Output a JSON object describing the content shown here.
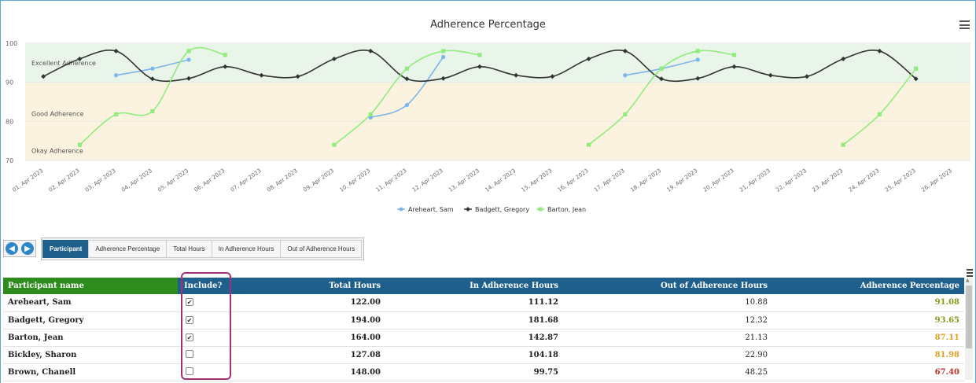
{
  "chart_data": {
    "type": "line",
    "title": "Adherence Percentage",
    "ylim": [
      70,
      100
    ],
    "yticks": [
      "70",
      "80",
      "90",
      "100"
    ],
    "bands": [
      {
        "label": "Excellent Adherence",
        "from": 90,
        "to": 100,
        "color": "#e9f5e9"
      },
      {
        "label": "Good Adherence",
        "from": 70,
        "to": 90,
        "color": "#fbf3e0"
      },
      {
        "label": "Okay Adherence",
        "from": 70,
        "to": 70,
        "color": "#fbf3e0"
      }
    ],
    "categories": [
      "01, Apr 2023",
      "02, Apr 2023",
      "03, Apr 2023",
      "04, Apr 2023",
      "05, Apr 2023",
      "06, Apr 2023",
      "07, Apr 2023",
      "08, Apr 2023",
      "09, Apr 2023",
      "10, Apr 2023",
      "11, Apr 2023",
      "12, Apr 2023",
      "13, Apr 2023",
      "14, Apr 2023",
      "15, Apr 2023",
      "16, Apr 2023",
      "17, Apr 2023",
      "18, Apr 2023",
      "19, Apr 2023",
      "20, Apr 2023",
      "21, Apr 2023",
      "22, Apr 2023",
      "23, Apr 2023",
      "24, Apr 2023",
      "25, Apr 2023",
      "26, Apr 2023"
    ],
    "series": [
      {
        "name": "Areheart, Sam",
        "color": "#7cb5ec",
        "marker": "circle",
        "values": [
          null,
          null,
          91.8,
          93.5,
          95.8,
          null,
          null,
          null,
          null,
          81.0,
          84.2,
          96.5,
          null,
          null,
          null,
          null,
          91.8,
          93.5,
          95.8,
          null,
          null,
          null,
          null,
          null,
          null,
          null
        ]
      },
      {
        "name": "Badgett, Gregory",
        "color": "#333333",
        "marker": "diamond",
        "values": [
          91.5,
          96.0,
          98.0,
          90.9,
          91.0,
          94.0,
          91.8,
          91.5,
          96.0,
          98.0,
          90.9,
          91.0,
          94.0,
          91.8,
          91.5,
          96.0,
          98.0,
          90.9,
          91.0,
          94.0,
          91.8,
          91.5,
          96.0,
          98.0,
          90.9,
          null
        ]
      },
      {
        "name": "Barton, Jean",
        "color": "#90ed7d",
        "marker": "square",
        "values": [
          null,
          74.0,
          81.8,
          82.6,
          98.0,
          97.0,
          null,
          null,
          74.0,
          81.8,
          93.5,
          98.0,
          97.0,
          null,
          null,
          74.0,
          81.8,
          93.5,
          98.0,
          97.0,
          null,
          null,
          74.0,
          81.8,
          93.5,
          null
        ]
      }
    ]
  },
  "tabs": {
    "items": [
      "Participant",
      "Adherence Percentage",
      "Total Hours",
      "In Adherence Hours",
      "Out of Adherence Hours"
    ]
  },
  "table": {
    "headers": {
      "name": "Participant name",
      "include": "Include?",
      "total": "Total Hours",
      "in": "In Adherence Hours",
      "out": "Out of Adherence Hours",
      "pct": "Adherence Percentage"
    },
    "rows": [
      {
        "name": "Areheart, Sam",
        "include": true,
        "total": "122.00",
        "in": "111.12",
        "out": "10.88",
        "pct": "91.08",
        "pct_color": "#8a9a1a"
      },
      {
        "name": "Badgett, Gregory",
        "include": true,
        "total": "194.00",
        "in": "181.68",
        "out": "12.32",
        "pct": "93.65",
        "pct_color": "#8a9a1a"
      },
      {
        "name": "Barton, Jean",
        "include": true,
        "total": "164.00",
        "in": "142.87",
        "out": "21.13",
        "pct": "87.11",
        "pct_color": "#e0a020"
      },
      {
        "name": "Bickley, Sharon",
        "include": false,
        "total": "127.08",
        "in": "104.18",
        "out": "22.90",
        "pct": "81.98",
        "pct_color": "#e0a020"
      },
      {
        "name": "Brown, Chanell",
        "include": false,
        "total": "148.00",
        "in": "99.75",
        "out": "48.25",
        "pct": "67.40",
        "pct_color": "#c0302a"
      }
    ]
  },
  "icons": {
    "prev": "arrow-left-circle-icon",
    "next": "arrow-right-circle-icon",
    "menu": "hamburger-menu-icon"
  }
}
